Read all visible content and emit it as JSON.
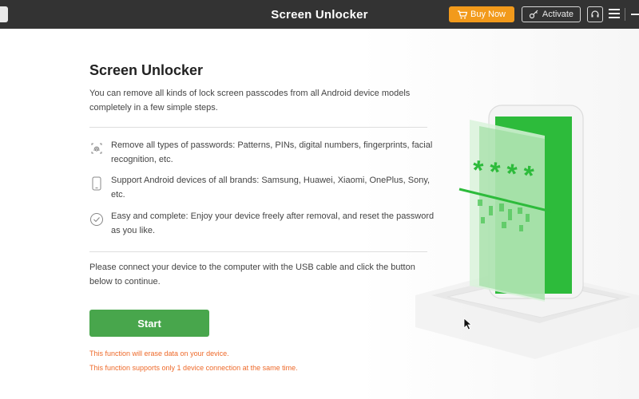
{
  "titlebar": {
    "title": "Screen Unlocker",
    "buy_label": "Buy Now",
    "activate_label": "Activate"
  },
  "main": {
    "heading": "Screen Unlocker",
    "description": "You can remove all kinds of lock screen passcodes from all Android device models completely in a few simple steps.",
    "features": [
      {
        "icon": "fingerprint-icon",
        "text": "Remove all types of passwords: Patterns, PINs, digital numbers, fingerprints, facial recognition, etc."
      },
      {
        "icon": "phone-icon",
        "text": "Support Android devices of all brands: Samsung, Huawei, Xiaomi, OnePlus, Sony, etc."
      },
      {
        "icon": "check-circle-icon",
        "text": "Easy and complete: Enjoy your device freely after removal, and reset the password as you like."
      }
    ],
    "connect_text": "Please connect your device to the computer with the USB cable and click the button below to continue.",
    "start_label": "Start",
    "warnings": [
      "This function will erase data on your device.",
      "This function supports only 1 device connection at the same time."
    ]
  },
  "illustration": {
    "asterisks": "****"
  },
  "colors": {
    "titlebar_bg": "#333333",
    "buy_button": "#f29a1b",
    "start_button": "#48a64c",
    "warning_text": "#ee6a2a",
    "phone_screen": "#2dbb3b"
  }
}
